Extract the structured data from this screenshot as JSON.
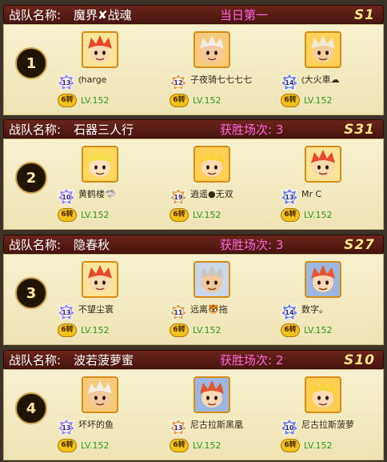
{
  "team_label": "战队名称:",
  "teams": [
    {
      "rank": "1",
      "name": "魔界✘战魂",
      "stat": "当日第一",
      "server": "S1",
      "members": [
        {
          "name": "⦅harge",
          "tier": "13",
          "rebirth": "6转",
          "level": "LV.152",
          "avatar": "red-spiky"
        },
        {
          "name": "子夜骑七七七七",
          "tier": "12",
          "rebirth": "6转",
          "level": "LV.152",
          "avatar": "white-hair"
        },
        {
          "name": "⦅大火車☁",
          "tier": "14",
          "rebirth": "6转",
          "level": "LV.152",
          "avatar": "grinning"
        }
      ]
    },
    {
      "rank": "2",
      "name": "石器三人行",
      "stat": "获胜场次: 3",
      "server": "S31",
      "members": [
        {
          "name": "黄鹤楼🦈",
          "tier": "10",
          "rebirth": "6转",
          "level": "LV.152",
          "avatar": "blonde-green"
        },
        {
          "name": "逍遥●无双",
          "tier": "19",
          "rebirth": "6转",
          "level": "LV.152",
          "avatar": "blonde"
        },
        {
          "name": "Mr C",
          "tier": "13",
          "rebirth": "6转",
          "level": "LV.152",
          "avatar": "red-spiky"
        }
      ]
    },
    {
      "rank": "3",
      "name": "隐春秋",
      "stat": "获胜场次: 3",
      "server": "S27",
      "members": [
        {
          "name": "不望尘寰",
          "tier": "13",
          "rebirth": "6转",
          "level": "LV.152",
          "avatar": "red-spiky"
        },
        {
          "name": "远离🐯拖",
          "tier": "11",
          "rebirth": "6转",
          "level": "LV.152",
          "avatar": "helmet"
        },
        {
          "name": "数字。",
          "tier": "14",
          "rebirth": "6转",
          "level": "LV.152",
          "avatar": "red-cap"
        }
      ]
    },
    {
      "rank": "4",
      "name": "波若菠萝蜜",
      "stat": "获胜场次: 2",
      "server": "S10",
      "members": [
        {
          "name": "坏坏的鱼",
          "tier": "13",
          "rebirth": "6转",
          "level": "LV.152",
          "avatar": "white-hair"
        },
        {
          "name": "尼古拉斯黑凰",
          "tier": "13",
          "rebirth": "6转",
          "level": "LV.152",
          "avatar": "red-cap"
        },
        {
          "name": "尼古拉斯菠萝",
          "tier": "10",
          "rebirth": "6转",
          "level": "LV.152",
          "avatar": "blonde"
        }
      ]
    }
  ],
  "colors": {
    "header_bg": "#5a1d16",
    "body_bg": "#f4edc8",
    "stat_text": "#ff66dd",
    "server_text": "#ffe38a",
    "level_text": "#2d9a1e",
    "avatar_border": "#d78c15"
  }
}
